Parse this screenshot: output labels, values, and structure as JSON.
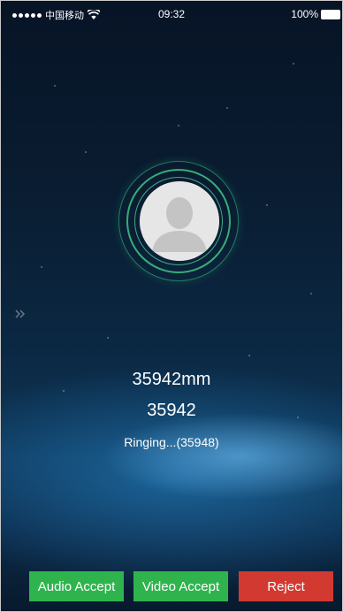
{
  "status_bar": {
    "carrier": "中国移动",
    "time": "09:32",
    "battery": "100%"
  },
  "caller": {
    "name": "35942mm",
    "number": "35942",
    "status": "Ringing...(35948)"
  },
  "actions": {
    "audio_accept": "Audio Accept",
    "video_accept": "Video Accept",
    "reject": "Reject"
  },
  "colors": {
    "accept": "#2fb44d",
    "reject": "#d23a31",
    "ring": "#3ddc8a"
  },
  "icons": [
    "wifi-icon",
    "battery-icon",
    "avatar-placeholder-icon",
    "double-chevron-right-icon"
  ]
}
